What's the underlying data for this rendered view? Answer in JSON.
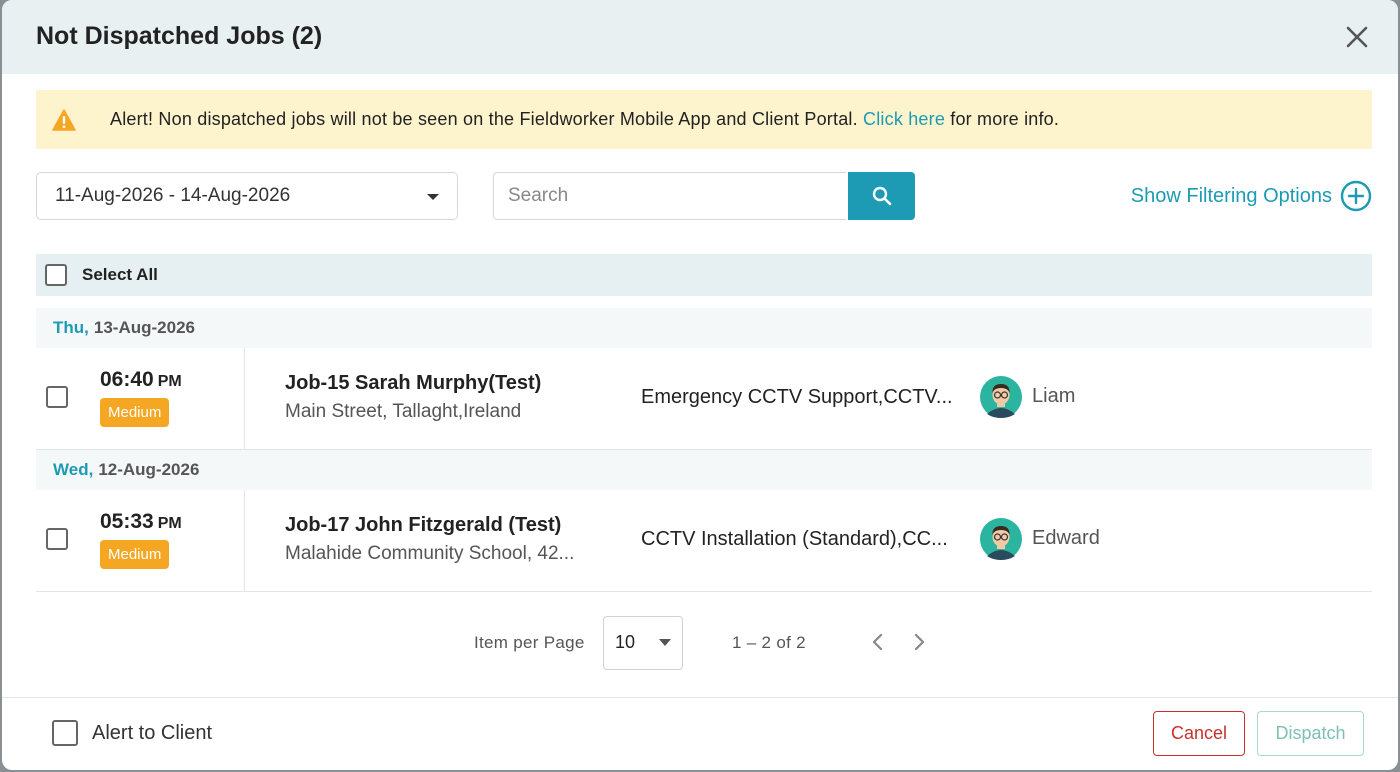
{
  "modal": {
    "title": "Not Dispatched Jobs (2)",
    "close_icon": "close-icon"
  },
  "alert": {
    "icon": "warning-icon",
    "text_before": "Alert! Non dispatched jobs will not be seen on the Fieldworker Mobile App and Client Portal. ",
    "link_text": "Click here",
    "text_after": " for more info.",
    "bg_color": "#fdf3cd"
  },
  "filters": {
    "date_range": "11-Aug-2026 - 14-Aug-2026",
    "search_placeholder": "Search",
    "search_value": "",
    "show_filtering_label": "Show Filtering Options"
  },
  "list": {
    "select_all_label": "Select All",
    "groups": [
      {
        "day_name": "Thu,",
        "day_date": "13-Aug-2026",
        "jobs": [
          {
            "time": "06:40",
            "ampm": "PM",
            "priority": "Medium",
            "title": "Job-15 Sarah Murphy(Test)",
            "address": "Main Street, Tallaght,Ireland",
            "service": "Emergency CCTV Support,CCTV...",
            "worker": "Liam"
          }
        ]
      },
      {
        "day_name": "Wed,",
        "day_date": "12-Aug-2026",
        "jobs": [
          {
            "time": "05:33",
            "ampm": "PM",
            "priority": "Medium",
            "title": "Job-17 John Fitzgerald (Test)",
            "address": "Malahide Community School, 42...",
            "service": "CCTV Installation (Standard),CC...",
            "worker": "Edward"
          }
        ]
      }
    ]
  },
  "pagination": {
    "items_per_page_label": "Item per Page",
    "items_per_page_value": "10",
    "range_label": "1 – 2 of 2"
  },
  "footer": {
    "alert_client_label": "Alert to Client",
    "cancel_label": "Cancel",
    "dispatch_label": "Dispatch"
  },
  "colors": {
    "accent": "#1d9bb4",
    "priority_medium": "#f5a623",
    "cancel": "#c9302c",
    "dispatch": "#7fbfb5"
  }
}
